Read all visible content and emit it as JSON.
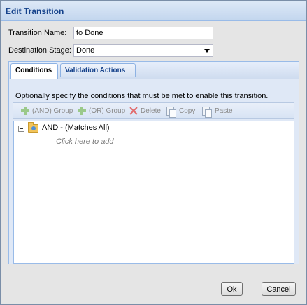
{
  "dialog": {
    "title": "Edit Transition"
  },
  "form": {
    "transition_name_label": "Transition Name:",
    "transition_name_value": "to Done",
    "destination_stage_label": "Destination Stage:",
    "destination_stage_value": "Done"
  },
  "tabs": [
    {
      "label": "Conditions",
      "active": true
    },
    {
      "label": "Validation Actions",
      "active": false
    }
  ],
  "conditions": {
    "description": "Optionally specify the conditions that must be met to enable this transition.",
    "toolbar": {
      "and_group": "(AND) Group",
      "or_group": "(OR) Group",
      "delete": "Delete",
      "copy": "Copy",
      "paste": "Paste"
    },
    "tree": {
      "root_label": "AND - (Matches All)",
      "add_hint": "Click here to add"
    }
  },
  "buttons": {
    "ok": "Ok",
    "cancel": "Cancel"
  },
  "icons": {
    "and_group": "plus-icon",
    "or_group": "plus-icon",
    "delete": "x-icon",
    "copy": "copy-icon",
    "paste": "paste-icon",
    "tree_toggle": "collapse-icon",
    "tree_node": "folder-icon"
  },
  "colors": {
    "title_text": "#15428b",
    "panel_bg": "#dfe8f6",
    "tab_border": "#8db2e3"
  }
}
